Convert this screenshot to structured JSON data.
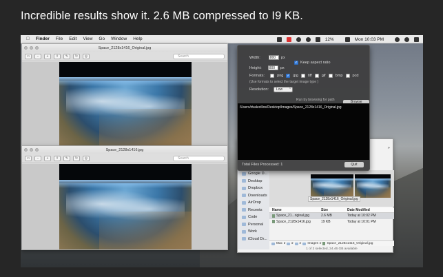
{
  "headline": "Incredible results show it. 2.6 MB compressed to I9 KB.",
  "menubar": {
    "apple": "",
    "items": [
      "Finder",
      "File",
      "Edit",
      "View",
      "Go",
      "Window",
      "Help"
    ],
    "battery": "12%",
    "clock": "Mon 10:03 PM"
  },
  "preview_top": {
    "title": "Space_2128x1416_Original.jpg",
    "search_placeholder": "Search"
  },
  "preview_bottom": {
    "title": "Space_2128x1416.jpg",
    "search_placeholder": "Search"
  },
  "app": {
    "width_label": "Width:",
    "width_value": "800",
    "width_unit": "px",
    "height_label": "Height:",
    "height_value": "800",
    "height_unit": "px",
    "keep_aspect_label": "Keep aspect ratio",
    "keep_aspect_checked": true,
    "formats_label": "Formats:",
    "formats": [
      {
        "label": "png",
        "checked": false
      },
      {
        "label": "jpg",
        "checked": true
      },
      {
        "label": "tiff",
        "checked": false
      },
      {
        "label": "gif",
        "checked": false
      },
      {
        "label": "bmp",
        "checked": false
      },
      {
        "label": "pcd",
        "checked": false
      }
    ],
    "formats_hint": "(Use formats to select the target image type )",
    "resolution_label": "Resolution:",
    "resolution_value": "Low",
    "browse_hint": "Run by browsing for path →",
    "browse_button": "Browse",
    "console_line": "/Users/dvalecillos/Desktop/Images/Space_2128x1416_Original.jpg",
    "total_files": "Total Files Processed: 1",
    "quit_button": "Quit"
  },
  "finder": {
    "sidebar": [
      "Google D...",
      "Desktop",
      "Dropbox",
      "Downloads",
      "AirDrop",
      "Recents",
      "Code",
      "Personal",
      "Work",
      "iCloud Dr..."
    ],
    "preview_label": "Space_2128x1416_Original.jpg",
    "columns": {
      "name": "Name",
      "size": "Size",
      "date": "Date Modified"
    },
    "files": [
      {
        "name": "Space_21...riginal.jpg",
        "size": "2.6 MB",
        "date": "Today at 10:02 PM"
      },
      {
        "name": "Space_2128x1416.jpg",
        "size": "19 KB",
        "date": "Today at 10:01 PM"
      }
    ],
    "path": [
      "Mac",
      "▸",
      "",
      "▸",
      "",
      "▸",
      "Images",
      "▸",
      "Space_2128x1416_Original.jpg"
    ],
    "status": "1 of 2 selected, 24.46 GB available"
  }
}
